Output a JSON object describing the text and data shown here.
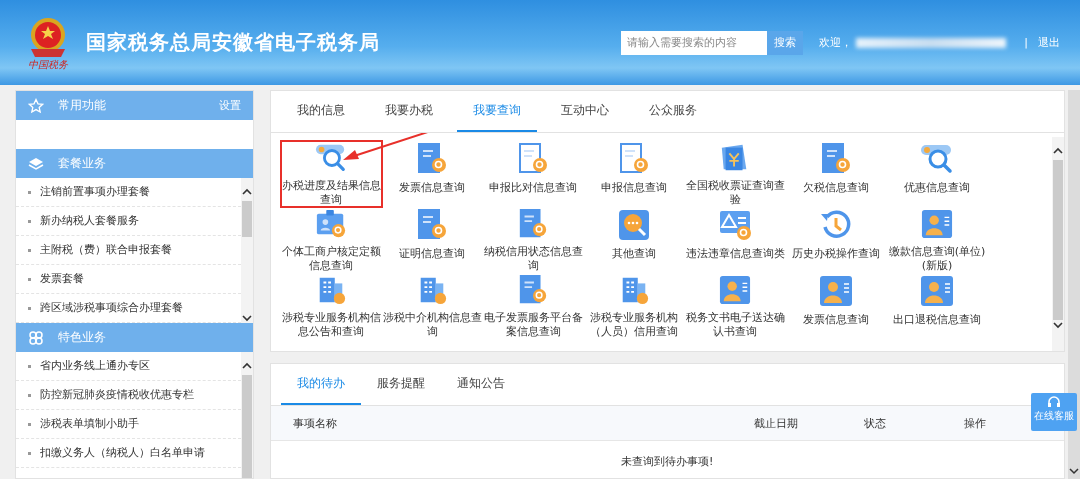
{
  "header": {
    "title": "国家税务总局安徽省电子税务局",
    "logo_caption": "中国税务",
    "search": {
      "placeholder": "请输入需要搜索的内容",
      "button": "搜索"
    },
    "welcome": "欢迎，",
    "separator": "|",
    "logout": "退出"
  },
  "sidebar": {
    "sections": [
      {
        "title": "常用功能",
        "kind": "star",
        "action": "设置"
      },
      {
        "title": "套餐业务",
        "kind": "layers",
        "items": [
          "注销前置事项办理套餐",
          "新办纳税人套餐服务",
          "主附税（费）联合申报套餐",
          "发票套餐",
          "跨区域涉税事项综合办理套餐"
        ]
      },
      {
        "title": "特色业务",
        "kind": "clover",
        "items": [
          "省内业务线上通办专区",
          "防控新冠肺炎疫情税收优惠专栏",
          "涉税表单填制小助手",
          "扣缴义务人（纳税人）白名单申请"
        ]
      }
    ]
  },
  "main_tabs": [
    {
      "label": "我的信息",
      "selected": false
    },
    {
      "label": "我要办税",
      "selected": false
    },
    {
      "label": "我要查询",
      "selected": true
    },
    {
      "label": "互动中心",
      "selected": false
    },
    {
      "label": "公众服务",
      "selected": false
    }
  ],
  "query_items": [
    {
      "label": "办税进度及结果信息查询",
      "kind": "magnifier",
      "highlighted": true
    },
    {
      "label": "发票信息查询",
      "kind": "doc",
      "highlighted": false
    },
    {
      "label": "申报比对信息查询",
      "kind": "note",
      "highlighted": false
    },
    {
      "label": "申报信息查询",
      "kind": "note",
      "highlighted": false
    },
    {
      "label": "全国税收票证查询查验",
      "kind": "ticket",
      "highlighted": false
    },
    {
      "label": "欠税信息查询",
      "kind": "doc",
      "highlighted": false
    },
    {
      "label": "优惠信息查询",
      "kind": "magnifier",
      "highlighted": false
    },
    {
      "label": "个体工商户核定定额信息查询",
      "kind": "badge",
      "highlighted": false
    },
    {
      "label": "证明信息查询",
      "kind": "doc",
      "highlighted": false
    },
    {
      "label": "纳税信用状态信息查询",
      "kind": "doc",
      "highlighted": false
    },
    {
      "label": "其他查询",
      "kind": "chat",
      "highlighted": false
    },
    {
      "label": "违法违章信息查询类",
      "kind": "warning",
      "highlighted": false
    },
    {
      "label": "历史办税操作查询",
      "kind": "history",
      "highlighted": false
    },
    {
      "label": "缴款信息查询(单位)(新版)",
      "kind": "person",
      "highlighted": false
    },
    {
      "label": "涉税专业服务机构信息公告和查询",
      "kind": "building",
      "highlighted": false
    },
    {
      "label": "涉税中介机构信息查询",
      "kind": "building",
      "highlighted": false
    },
    {
      "label": "电子发票服务平台备案信息查询",
      "kind": "doc",
      "highlighted": false
    },
    {
      "label": "涉税专业服务机构（人员）信用查询",
      "kind": "building",
      "highlighted": false
    },
    {
      "label": "税务文书电子送达确认书查询",
      "kind": "person",
      "highlighted": false
    },
    {
      "label": "发票信息查询",
      "kind": "person",
      "highlighted": false
    },
    {
      "label": "出口退税信息查询",
      "kind": "person",
      "highlighted": false
    }
  ],
  "todo": {
    "tabs": [
      {
        "label": "我的待办",
        "selected": true
      },
      {
        "label": "服务提醒",
        "selected": false
      },
      {
        "label": "通知公告",
        "selected": false
      }
    ],
    "columns": [
      "事项名称",
      "截止日期",
      "状态",
      "操作"
    ],
    "empty_message": "未查询到待办事项!"
  },
  "service_button": "在线客服"
}
